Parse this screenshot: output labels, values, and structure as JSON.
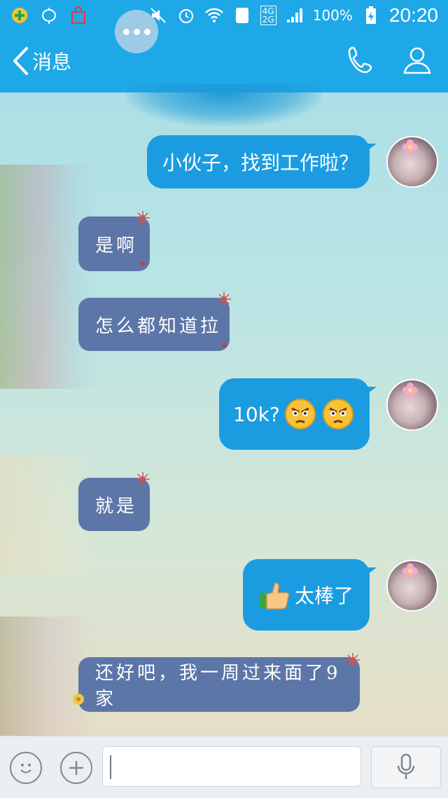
{
  "status_bar": {
    "battery": "100%",
    "time": "20:20",
    "network_4g": "4G",
    "network_2g": "2G"
  },
  "header": {
    "back_label": "消息"
  },
  "messages": [
    {
      "direction": "out",
      "text": "小伙子，找到工作啦？"
    },
    {
      "direction": "in",
      "text": "是啊"
    },
    {
      "direction": "in",
      "text": "怎么都知道拉"
    },
    {
      "direction": "out",
      "text": "10k?",
      "emojis": [
        "angry-face-icon",
        "angry-face-icon"
      ]
    },
    {
      "direction": "in",
      "text": "就是"
    },
    {
      "direction": "out",
      "text": "太棒了",
      "emoji_before": "thumbs-up-icon"
    },
    {
      "direction": "in",
      "text": "还好吧，我一周过来面了9家"
    }
  ],
  "colors": {
    "accent": "#1fa8e8",
    "outgoing_bubble": "#1b9ce0",
    "incoming_bubble": "#5d76a8"
  }
}
